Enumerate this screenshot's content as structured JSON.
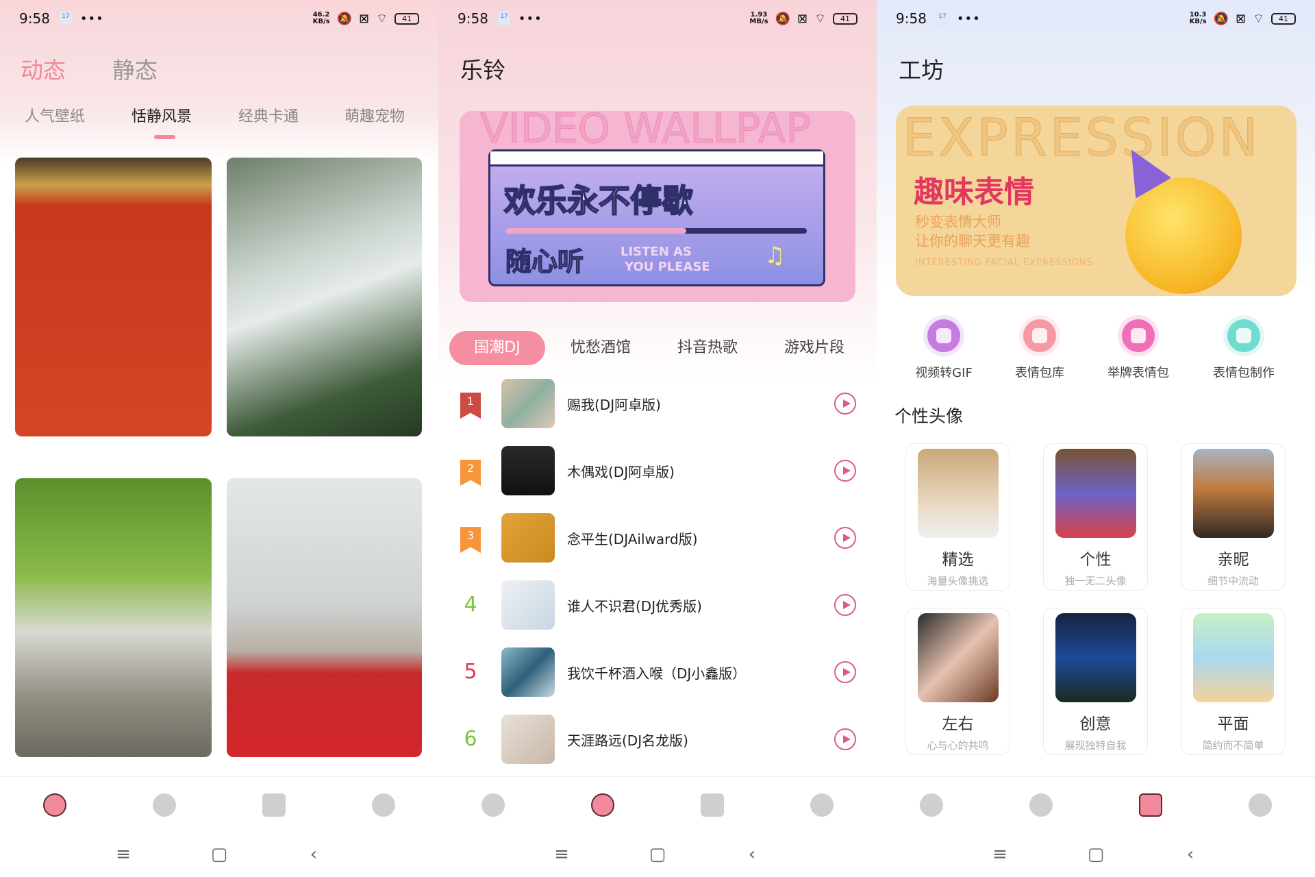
{
  "colors": {
    "accent_pink": "#f48ea0",
    "play_pink": "#e0588a",
    "rank1": "#cc4b43",
    "rank2_3": "#f7953b",
    "rank_green": "#7ac443",
    "rank_red": "#e23a55",
    "banner_yellow": "#f4d59a",
    "banner_red": "#e2375f"
  },
  "status_bars": [
    {
      "time": "9:58",
      "calendar": "17",
      "speed_value": "46.2",
      "speed_unit": "KB/s",
      "battery": "41"
    },
    {
      "time": "9:58",
      "calendar": "17",
      "speed_value": "1.93",
      "speed_unit": "MB/s",
      "battery": "41"
    },
    {
      "time": "9:58",
      "calendar": "17",
      "speed_value": "10.3",
      "speed_unit": "KB/s",
      "battery": "41"
    }
  ],
  "wallpaper": {
    "top_tabs": [
      {
        "label": "动态",
        "active": true
      },
      {
        "label": "静态",
        "active": false
      }
    ],
    "sub_tabs": [
      {
        "label": "人气壁纸"
      },
      {
        "label": "恬静风景",
        "active": true
      },
      {
        "label": "经典卡通"
      },
      {
        "label": "萌趣宠物"
      }
    ],
    "images": [
      "red-wall-plum-blossom",
      "misty-mountain-peaks",
      "garden-moon-gate",
      "bare-tree-red-wall"
    ]
  },
  "ringtone": {
    "title": "乐铃",
    "banner": {
      "headline": "欢乐永不停歇",
      "subline": "随心听",
      "english_1": "LISTEN AS",
      "english_2": "YOU PLEASE",
      "bg_text": "VIDEO WALLPAP",
      "progress": 0.6
    },
    "chips": [
      {
        "label": "国潮DJ",
        "active": true
      },
      {
        "label": "忧愁酒馆"
      },
      {
        "label": "抖音热歌"
      },
      {
        "label": "游戏片段"
      }
    ],
    "songs": [
      {
        "rank": "1",
        "title": "赐我(DJ阿卓版)"
      },
      {
        "rank": "2",
        "title": "木偶戏(DJ阿卓版)"
      },
      {
        "rank": "3",
        "title": "念平生(DJAilward版)"
      },
      {
        "rank": "4",
        "title": "谁人不识君(DJ优秀版)"
      },
      {
        "rank": "5",
        "title": "我饮千杯酒入喉（DJ小鑫版）"
      },
      {
        "rank": "6",
        "title": "天涯路远(DJ名龙版)"
      }
    ]
  },
  "workshop": {
    "title": "工坊",
    "banner": {
      "bg_text": "EXPRESSION",
      "headline": "趣味表情",
      "line1": "秒变表情大师",
      "line2": "让你的聊天更有趣",
      "english": "INTERESTING FACIAL EXPRESSIONS"
    },
    "tools": [
      {
        "label": "视频转GIF",
        "icon": "video-camera-icon",
        "color": "#c77be0"
      },
      {
        "label": "表情包库",
        "icon": "smile-face-icon",
        "color": "#f59aa3"
      },
      {
        "label": "举牌表情包",
        "icon": "magic-wand-icon",
        "color": "#f06fb6"
      },
      {
        "label": "表情包制作",
        "icon": "grid-add-icon",
        "color": "#6fdccf"
      }
    ],
    "section_title": "个性头像",
    "avatar_categories": [
      {
        "name": "精选",
        "desc": "海量头像挑选"
      },
      {
        "name": "个性",
        "desc": "独一无二头像"
      },
      {
        "name": "亲昵",
        "desc": "细节中流动"
      },
      {
        "name": "左右",
        "desc": "心与心的共鸣"
      },
      {
        "name": "创意",
        "desc": "展现独特自我"
      },
      {
        "name": "平面",
        "desc": "简约而不简单"
      }
    ]
  },
  "bottom_nav": {
    "items": [
      "home-icon",
      "music-icon",
      "apps-grid-icon",
      "profile-icon"
    ],
    "active_per_panel": [
      0,
      1,
      2
    ]
  }
}
